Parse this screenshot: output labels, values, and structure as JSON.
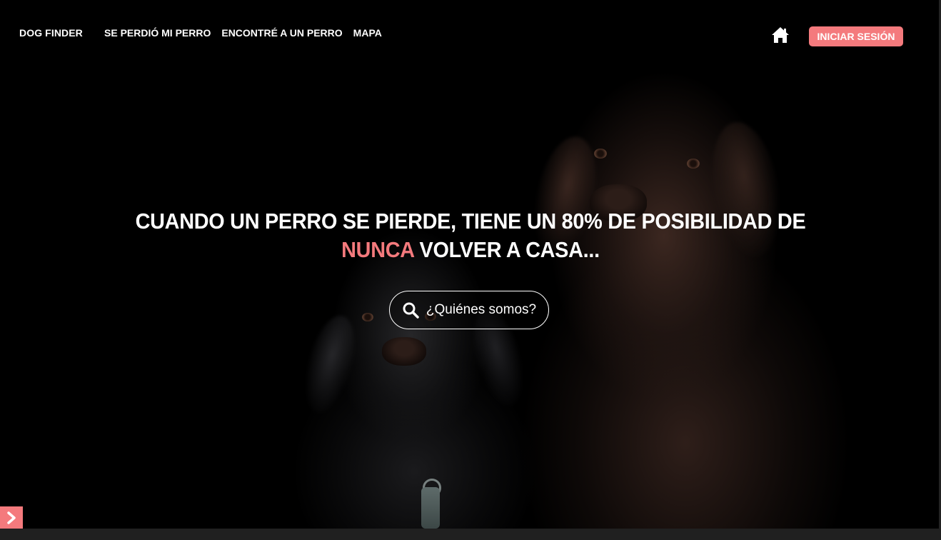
{
  "nav": {
    "brand": "DOG FINDER",
    "links": [
      {
        "label": "SE PERDIÓ MI PERRO"
      },
      {
        "label": "ENCONTRÉ A UN PERRO"
      },
      {
        "label": "MAPA"
      }
    ],
    "home_icon": "home-icon",
    "login_label": "INICIAR SESIÓN"
  },
  "hero": {
    "headline_line1": "CUANDO UN PERRO SE PIERDE, TIENE UN 80% DE POSIBILIDAD DE",
    "headline_accent": "NUNCA",
    "headline_line2_rest": " VOLVER A CASA...",
    "about_button": {
      "icon": "search-icon",
      "label": "¿Quiénes somos?"
    }
  },
  "side_toggle": {
    "icon": "chevron-right-icon"
  },
  "colors": {
    "accent": "#f47a7d",
    "background": "#000000",
    "text": "#ffffff"
  }
}
